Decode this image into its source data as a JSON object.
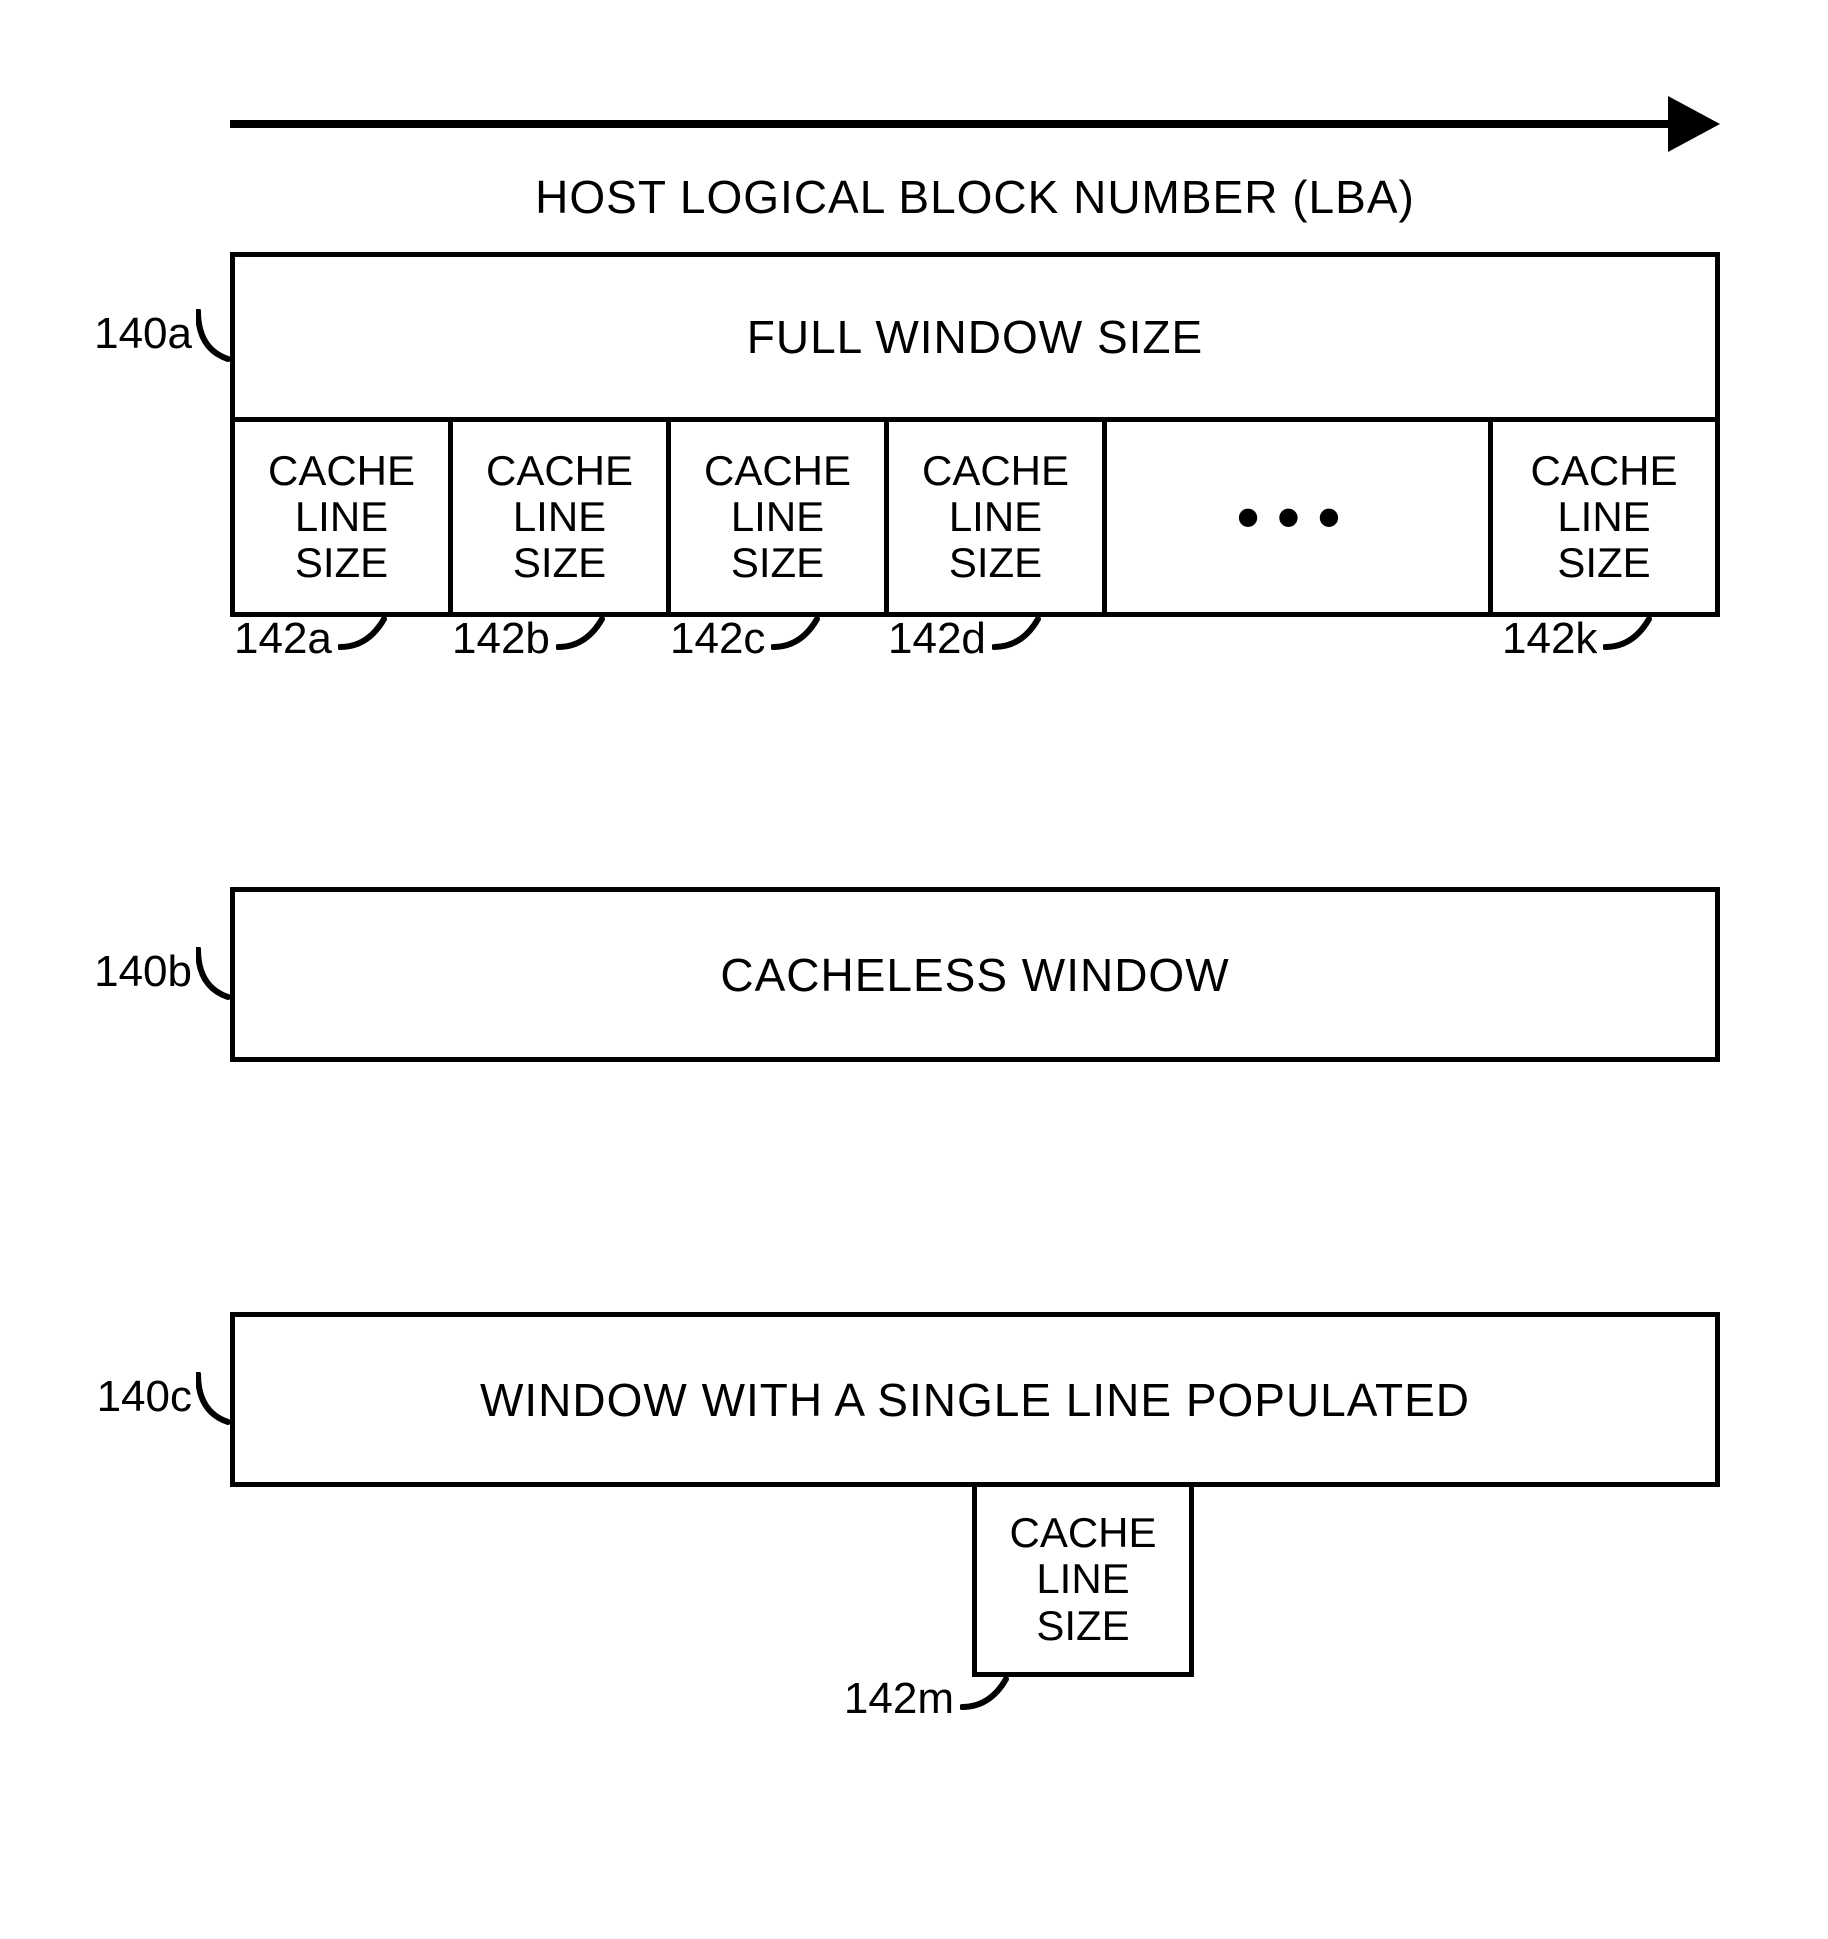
{
  "axis_label": "HOST LOGICAL BLOCK NUMBER (LBA)",
  "window_a": {
    "ref": "140a",
    "title": "FULL WINDOW SIZE",
    "cells": [
      {
        "label": "CACHE\nLINE\nSIZE",
        "ref": "142a"
      },
      {
        "label": "CACHE\nLINE\nSIZE",
        "ref": "142b"
      },
      {
        "label": "CACHE\nLINE\nSIZE",
        "ref": "142c"
      },
      {
        "label": "CACHE\nLINE\nSIZE",
        "ref": "142d"
      }
    ],
    "ellipsis": "•••",
    "last_cell": {
      "label": "CACHE\nLINE\nSIZE",
      "ref": "142k"
    }
  },
  "window_b": {
    "ref": "140b",
    "title": "CACHELESS WINDOW"
  },
  "window_c": {
    "ref": "140c",
    "title": "WINDOW WITH A SINGLE LINE POPULATED",
    "cell": {
      "label": "CACHE\nLINE\nSIZE",
      "ref": "142m"
    }
  }
}
